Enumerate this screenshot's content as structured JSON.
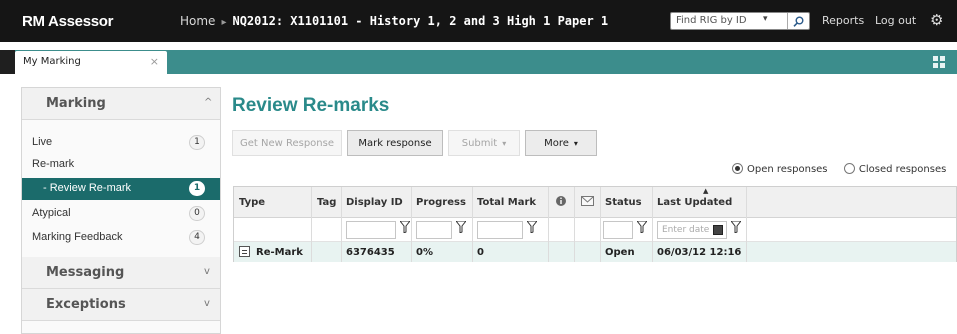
{
  "app": {
    "logo": "RM Assessor"
  },
  "header": {
    "home_label": "Home",
    "title": "NQ2012: X1101101 - History 1, 2 and 3 High 1 Paper 1",
    "rig_search_placeholder": "Find RIG by ID",
    "reports_label": "Reports",
    "logout_label": "Log out"
  },
  "tabs": [
    {
      "label": "My Marking",
      "close": "×"
    }
  ],
  "sidebar": {
    "sections": [
      {
        "label": "Marking",
        "arrow": "^"
      },
      {
        "label": "Messaging",
        "arrow": "v"
      },
      {
        "label": "Exceptions",
        "arrow": "v"
      }
    ],
    "items": [
      {
        "label": "Live",
        "count": "1"
      },
      {
        "label": "Re-mark",
        "count": ""
      },
      {
        "label": "- Review Re-mark",
        "count": "1"
      },
      {
        "label": "Atypical",
        "count": "0"
      },
      {
        "label": "Marking Feedback",
        "count": "4"
      }
    ]
  },
  "main": {
    "title": "Review Re-marks",
    "buttons": {
      "get_new_response": "Get New Response",
      "mark_response": "Mark response",
      "submit": "Submit",
      "more": "More"
    },
    "filters": {
      "open_responses": "Open responses",
      "closed_responses": "Closed responses",
      "open_selected": true
    }
  },
  "table": {
    "columns": [
      "Type",
      "Tag",
      "Display ID",
      "Progress",
      "Total Mark",
      "Status",
      "Last Updated"
    ],
    "date_placeholder": "Enter date",
    "rows": [
      {
        "type": "Re-Mark",
        "tag": "",
        "display_id": "6376435",
        "progress": "0%",
        "total_mark": "0",
        "status": "Open",
        "last_updated": "06/03/12 12:16"
      }
    ]
  },
  "colors": {
    "accent": "#2a8a8a",
    "active": "#1b6b6b",
    "topbar": "#151515"
  }
}
